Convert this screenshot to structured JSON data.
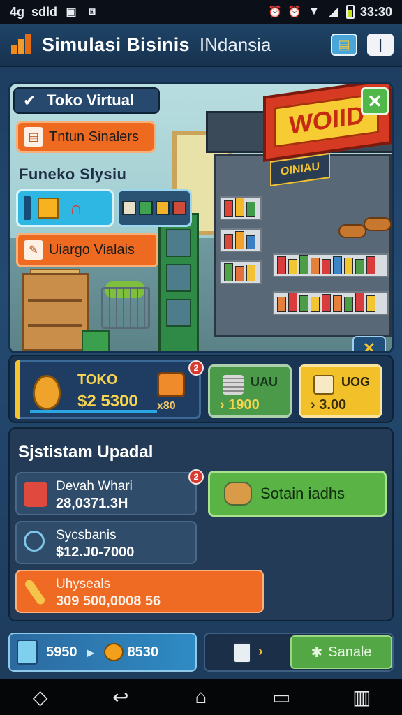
{
  "status_bar": {
    "network": "4g",
    "carrier": "sdld",
    "time": "33:30"
  },
  "header": {
    "title": "Simulasi Bisinis",
    "subtitle": "INdansia"
  },
  "scene": {
    "label": "Toko Virtual",
    "sign_text": "WOIID",
    "banner_text": "OINIAU",
    "button_top": "Tntun Sinalers",
    "section_label": "Funeko Slysiu",
    "button_bottom": "Uiargo Vialais"
  },
  "stats": {
    "main": {
      "title": "TOKO",
      "value": "$2 5300",
      "small": "x80",
      "badge": "2"
    },
    "green": {
      "title": "UAU",
      "value": "› 1900"
    },
    "yellow": {
      "title": "UOG",
      "value": "› 3.00"
    }
  },
  "panel": {
    "title": "Sjstistam Upadal",
    "item1": {
      "line1": "Devah Whari",
      "line2": "28,0371.3H",
      "badge": "2"
    },
    "item2": {
      "line1": "Sycsbanis",
      "line2": "$12.J0-7000"
    },
    "item3": {
      "line1": "Uhyseals",
      "line2": "309 500,0008 56"
    },
    "action_button": "Sotain iadhs"
  },
  "bottom": {
    "left_value_1": "5950",
    "left_value_2": "8530",
    "share_label": "Sanale"
  },
  "colors": {
    "accent_orange": "#ee6a21",
    "accent_green": "#4fb848",
    "accent_yellow": "#f2c12a",
    "panel_bg": "#233b56"
  }
}
